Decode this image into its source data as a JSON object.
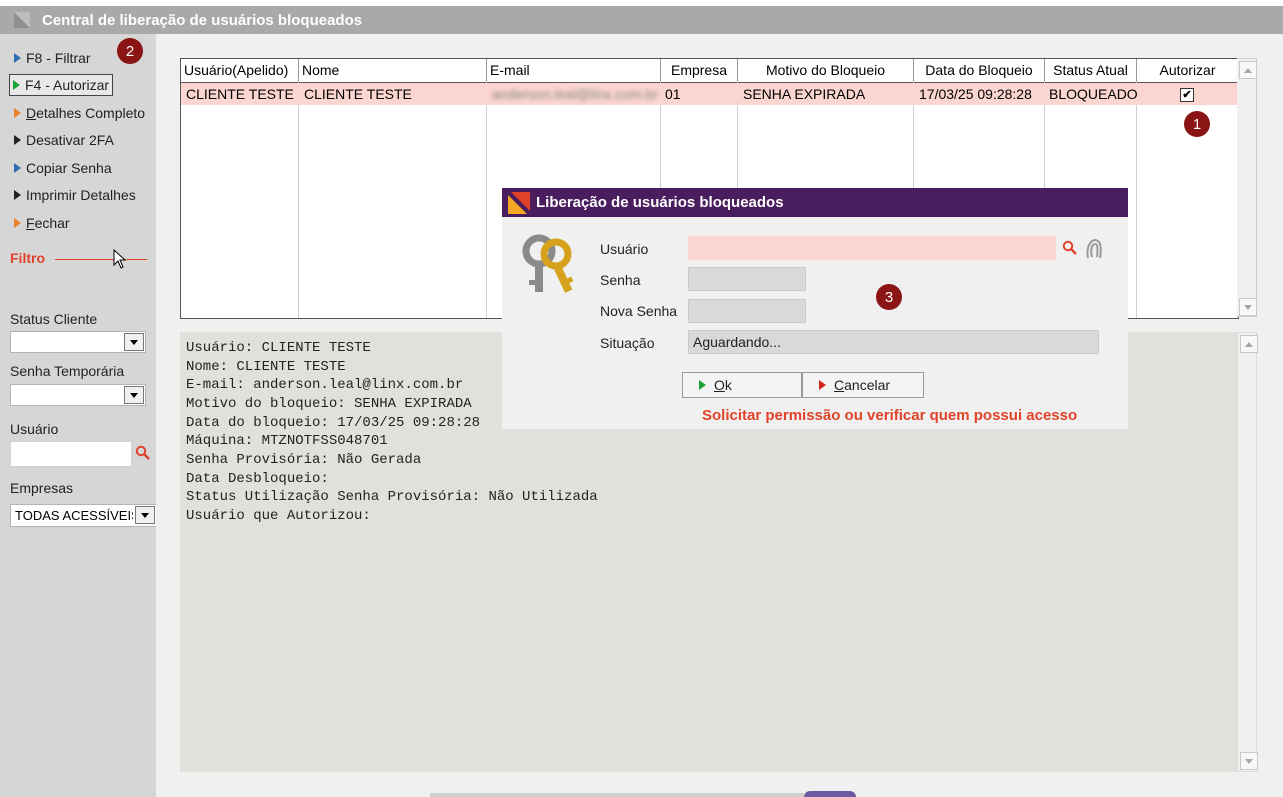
{
  "window": {
    "title": "Central de liberação de usuários bloqueados"
  },
  "sidebar": {
    "menu": [
      {
        "label": "F8 - Filtrar",
        "icon": "arrow-blue-icon"
      },
      {
        "label": "F4 - Autorizar",
        "icon": "arrow-green-icon"
      },
      {
        "label_key": "D",
        "label_rest": "etalhes Completo",
        "icon": "arrow-orange-icon"
      },
      {
        "label": "Desativar 2FA",
        "icon": "arrow-dark-icon"
      },
      {
        "label": "Copiar Senha",
        "icon": "arrow-blue-icon"
      },
      {
        "label": "Imprimir Detalhes",
        "icon": "arrow-dark-icon"
      },
      {
        "label_key": "F",
        "label_rest": "echar",
        "icon": "arrow-orange-icon"
      }
    ],
    "filtro_title": "Filtro",
    "status_cliente_label": "Status Cliente",
    "status_cliente_value": "",
    "senha_temporaria_label": "Senha Temporária",
    "senha_temporaria_value": "",
    "usuario_label": "Usuário",
    "usuario_value": "",
    "empresas_label": "Empresas",
    "empresas_value": "TODAS ACESSÍVEIS"
  },
  "badges": {
    "b1": "1",
    "b2": "2",
    "b3": "3"
  },
  "grid": {
    "columns": [
      "Usuário(Apelido)",
      "Nome",
      "E-mail",
      "Empresa",
      "Motivo do Bloqueio",
      "Data do Bloqueio",
      "Status Atual",
      "Autorizar"
    ],
    "rows": [
      {
        "usuario": "CLIENTE TESTE",
        "nome": "CLIENTE TESTE",
        "email": "anderson.leal@linx.com.br",
        "empresa": "01",
        "motivo": "SENHA EXPIRADA",
        "data": "17/03/25 09:28:28",
        "status": "BLOQUEADO",
        "autorizar": "✔"
      }
    ]
  },
  "details": {
    "lines": [
      "Usuário: CLIENTE TESTE",
      "Nome: CLIENTE TESTE",
      "E-mail: anderson.leal@linx.com.br",
      "Motivo do bloqueio: SENHA EXPIRADA",
      "Data do bloqueio: 17/03/25 09:28:28",
      "Máquina: MTZNOTFSS048701",
      "Senha Provisória: Não Gerada",
      "Data Desbloqueio:",
      "Status Utilização Senha Provisória: Não Utilizada",
      "Usuário que Autorizou:"
    ]
  },
  "dialog": {
    "title": "Liberação de usuários bloqueados",
    "usuario_label": "Usuário",
    "usuario_value": "",
    "senha_label": "Senha",
    "senha_value": "",
    "nova_senha_label": "Nova Senha",
    "nova_senha_value": "",
    "situacao_label": "Situação",
    "situacao_value": "Aguardando...",
    "ok_key": "O",
    "ok_rest": "k",
    "cancel_key": "C",
    "cancel_rest": "ancelar",
    "warning": "Solicitar permissão ou verificar quem possui acesso"
  },
  "colors": {
    "accent_purple": "#4a1d5e",
    "row_highlight": "#fbd5cf",
    "warning_red": "#e0432a",
    "badge_red": "#8b1414"
  }
}
